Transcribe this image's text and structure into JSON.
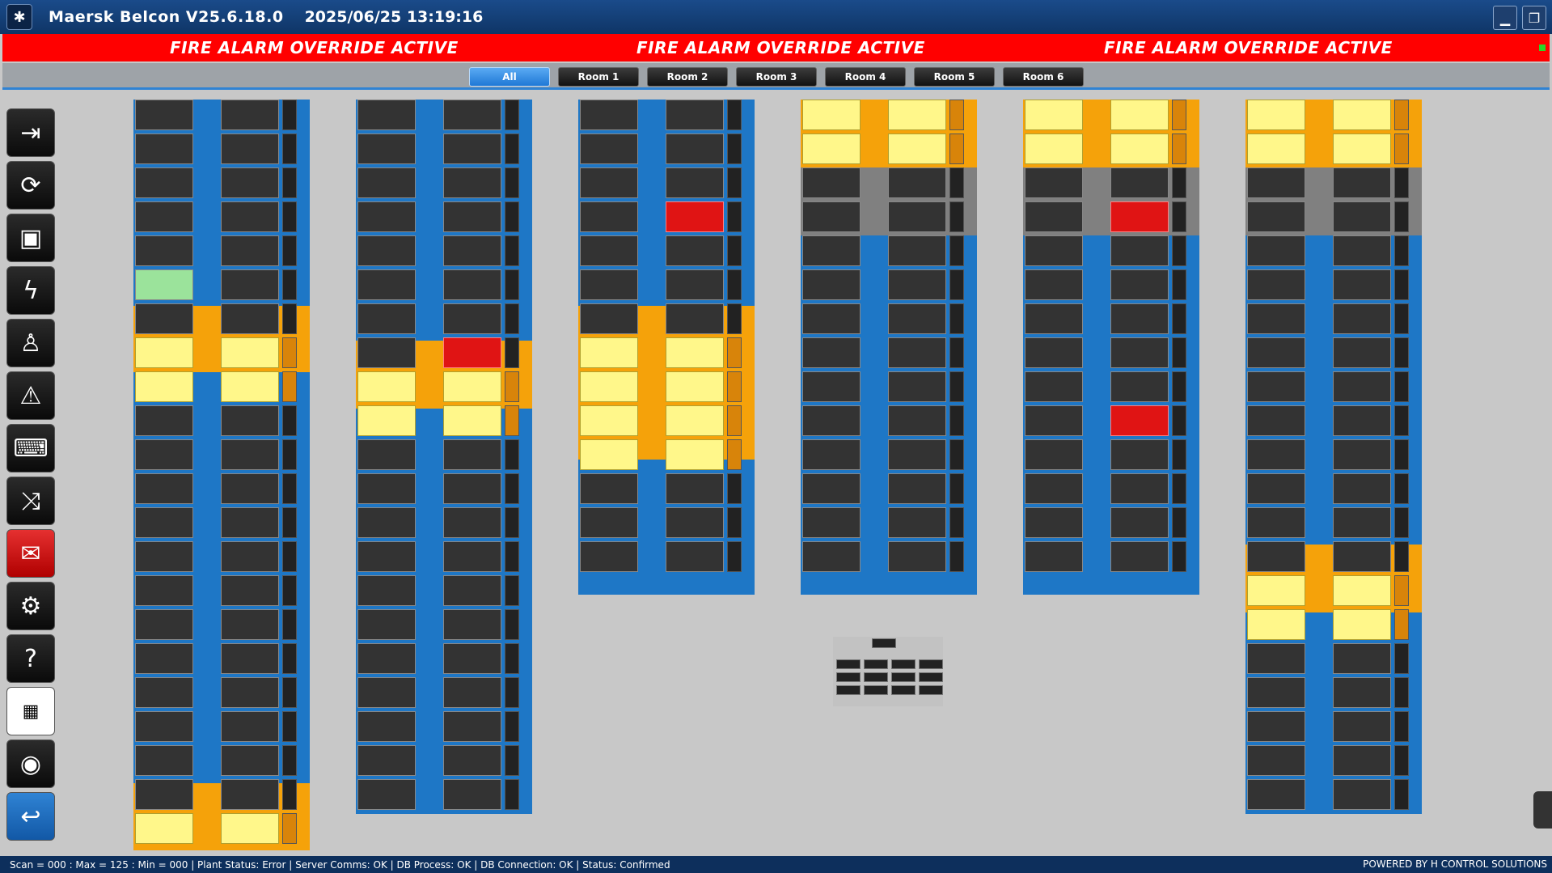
{
  "window": {
    "title": "Maersk Belcon V25.6.18.0",
    "datetime": "2025/06/25 13:19:16",
    "minimize_icon": "minimize-icon",
    "restore_icon": "restore-icon",
    "app_icon": "network-icon"
  },
  "alarm": {
    "messages": [
      "FIRE ALARM OVERRIDE ACTIVE",
      "FIRE ALARM OVERRIDE ACTIVE",
      "FIRE ALARM OVERRIDE ACTIVE"
    ],
    "color": "#ff0000",
    "led_color": "#27d827"
  },
  "tabs": [
    {
      "label": "All",
      "active": true
    },
    {
      "label": "Room 1",
      "active": false
    },
    {
      "label": "Room 2",
      "active": false
    },
    {
      "label": "Room 3",
      "active": false
    },
    {
      "label": "Room 4",
      "active": false
    },
    {
      "label": "Room 5",
      "active": false
    },
    {
      "label": "Room 6",
      "active": false
    }
  ],
  "sidebar": {
    "buttons": [
      {
        "name": "login",
        "icon": "login-arrow-icon"
      },
      {
        "name": "refresh",
        "icon": "refresh-icon"
      },
      {
        "name": "save",
        "icon": "save-icon"
      },
      {
        "name": "power",
        "icon": "lightning-icon"
      },
      {
        "name": "operator",
        "icon": "operator-icon"
      },
      {
        "name": "alarm-reset",
        "icon": "warning-clear-icon"
      },
      {
        "name": "keyboard",
        "icon": "keyboard-icon"
      },
      {
        "name": "shuffle",
        "icon": "shuffle-icon"
      },
      {
        "name": "mail",
        "icon": "mail-icon"
      },
      {
        "name": "user-settings",
        "icon": "user-gear-icon"
      },
      {
        "name": "help",
        "icon": "help-icon"
      },
      {
        "name": "qr-code",
        "icon": "qr-code-icon"
      },
      {
        "name": "view",
        "icon": "eye-icon"
      },
      {
        "name": "switch",
        "icon": "return-arrow-icon"
      }
    ]
  },
  "status": {
    "text": " Scan = 000 : Max = 125 : Min = 000  |  Plant Status: Error  |  Server Comms: OK  |  DB Process: OK  |  DB Connection:  OK  |  Status: Confirmed",
    "powered_by": "POWERED BY H CONTROL SOLUTIONS"
  },
  "colors": {
    "room_blue": "#1e77c6",
    "ripening_orange": "#f5a20a",
    "idle_gray": "#808080",
    "alarm_red": "#e01414",
    "tab_active": "#2f83d4"
  }
}
